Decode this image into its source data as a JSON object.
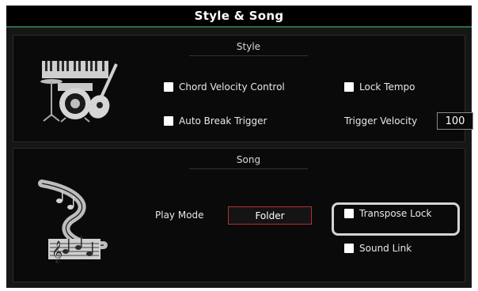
{
  "window": {
    "title": "Style & Song"
  },
  "style_section": {
    "heading": "Style",
    "chord_velocity_control": {
      "label": "Chord Velocity Control",
      "checked": false
    },
    "lock_tempo": {
      "label": "Lock Tempo",
      "checked": false
    },
    "auto_break_trigger": {
      "label": "Auto Break Trigger",
      "checked": false
    },
    "trigger_velocity": {
      "label": "Trigger Velocity",
      "value": "100"
    },
    "icon": "drums-keyboard-guitar-icon"
  },
  "song_section": {
    "heading": "Song",
    "play_mode": {
      "label": "Play Mode",
      "value": "Folder"
    },
    "transpose_lock": {
      "label": "Transpose Lock",
      "checked": false
    },
    "sound_link": {
      "label": "Sound Link",
      "checked": false
    },
    "icon": "music-notes-ribbon-icon"
  },
  "colors": {
    "background": "#161616",
    "title_bar": "#000000",
    "accent_line": "#2f6b43",
    "play_mode_border": "#b03030",
    "highlight": "#d4d4d4"
  }
}
